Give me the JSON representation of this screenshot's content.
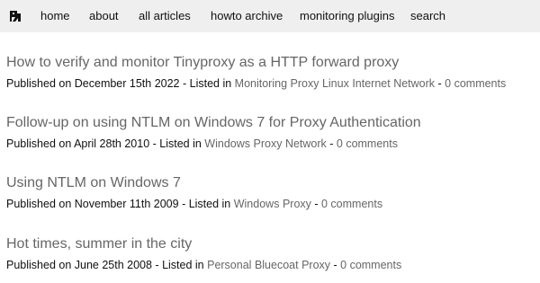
{
  "nav": {
    "logo_icon": "site-logo-icon",
    "items": [
      "home",
      "about",
      "all articles",
      "howto archive",
      "monitoring plugins",
      "search"
    ]
  },
  "posts": [
    {
      "title": "How to verify and monitor Tinyproxy as a HTTP forward proxy",
      "published_prefix": "Published on ",
      "date": "December 15th 2022",
      "listed_prefix": " - Listed in ",
      "tags": [
        "Monitoring",
        "Proxy",
        "Linux",
        "Internet",
        "Network"
      ],
      "comments_text": "0 comments"
    },
    {
      "title": "Follow-up on using NTLM on Windows 7 for Proxy Authentication",
      "published_prefix": "Published on ",
      "date": "April 28th 2010",
      "listed_prefix": " - Listed in ",
      "tags": [
        "Windows",
        "Proxy",
        "Network"
      ],
      "comments_text": "0 comments"
    },
    {
      "title": "Using NTLM on Windows 7",
      "published_prefix": "Published on ",
      "date": "November 11th 2009",
      "listed_prefix": " - Listed in ",
      "tags": [
        "Windows",
        "Proxy"
      ],
      "comments_text": "0 comments"
    },
    {
      "title": "Hot times, summer in the city",
      "published_prefix": "Published on ",
      "date": "June 25th 2008",
      "listed_prefix": " - Listed in ",
      "tags": [
        "Personal",
        "Bluecoat",
        "Proxy"
      ],
      "comments_text": "0 comments"
    }
  ],
  "colors": {
    "nav_background": "#efefef",
    "link_gray": "#666666",
    "text": "#111111"
  }
}
